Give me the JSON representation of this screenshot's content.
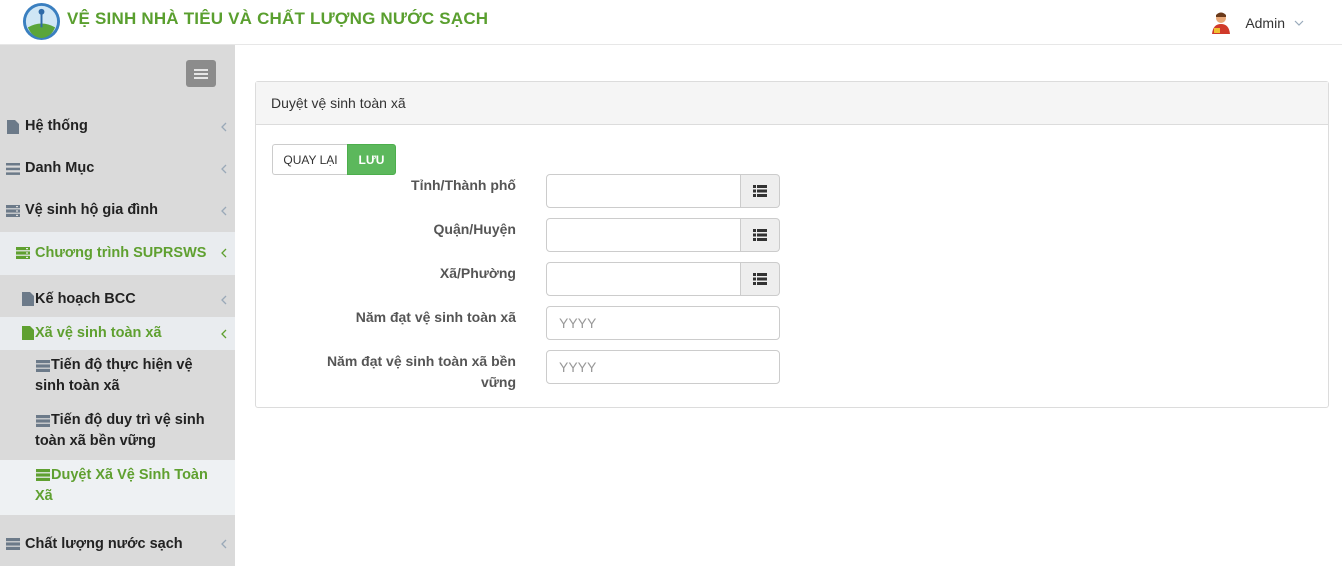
{
  "header": {
    "title": "VỆ SINH NHÀ TIÊU VÀ CHẤT LƯỢNG NƯỚC SẠCH",
    "user_name": "Admin"
  },
  "sidebar": {
    "items": [
      {
        "label": "Hệ thống"
      },
      {
        "label": "Danh Mục"
      },
      {
        "label": "Vệ sinh hộ gia đình"
      },
      {
        "label": "Chương trình SUPRSWS"
      },
      {
        "label": "Kế hoạch BCC"
      },
      {
        "label": "Xã vệ sinh toàn xã"
      },
      {
        "label_line1": "Tiến độ thực hiện vệ",
        "label_line2": "sinh toàn xã"
      },
      {
        "label_line1": "Tiến độ duy trì vệ sinh",
        "label_line2": "toàn xã bền vững"
      },
      {
        "label_line1": "Duyệt Xã Vệ Sinh Toàn",
        "label_line2": "Xã"
      },
      {
        "label": "Chất lượng nước sạch"
      }
    ]
  },
  "panel": {
    "title": "Duyệt vệ sinh toàn xã",
    "back_label": "QUAY LẠI",
    "save_label": "LƯU",
    "fields": {
      "province": {
        "label": "Tỉnh/Thành phố",
        "value": ""
      },
      "district": {
        "label": "Quận/Huyện",
        "value": ""
      },
      "commune": {
        "label": "Xã/Phường",
        "value": ""
      },
      "year": {
        "label": "Năm đạt vệ sinh toàn xã",
        "placeholder": "YYYY"
      },
      "year_sustain": {
        "label_line1": "Năm đạt vệ sinh toàn xã bền",
        "label_line2": "vững",
        "placeholder": "YYYY"
      }
    }
  },
  "colors": {
    "brand_green": "#5a9f2f",
    "save_button": "#5cb85c",
    "sidebar_bg": "#dadada"
  }
}
